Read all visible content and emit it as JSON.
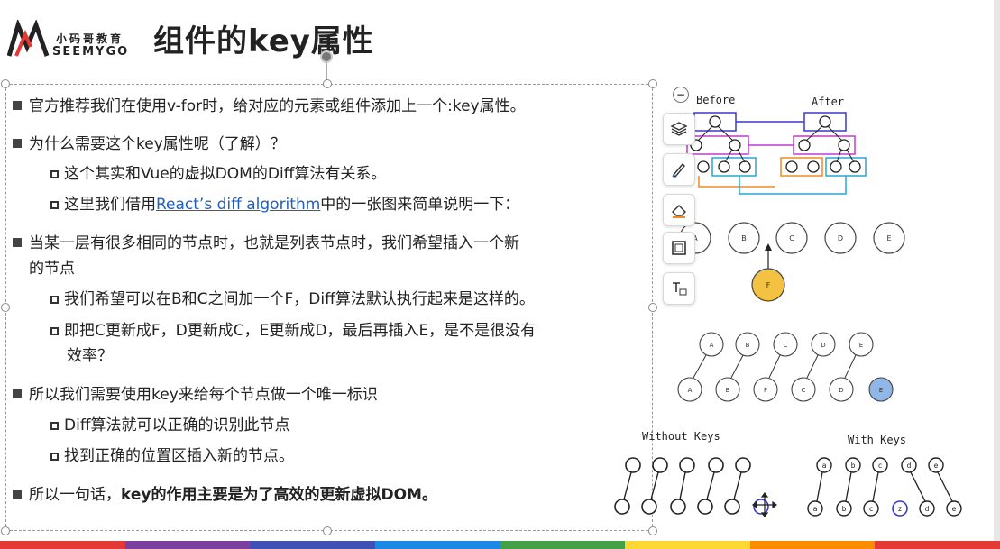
{
  "brand": {
    "name_cn": "小码哥教育",
    "name_en": "SEEMYGO",
    "accent": "#e53935"
  },
  "slide": {
    "title": "组件的key属性"
  },
  "content": {
    "l1": "官方推荐我们在使用v-for时，给对应的元素或组件添加上一个:key属性。",
    "l2": "为什么需要这个key属性呢（了解）？",
    "l3": "这个其实和Vue的虚拟DOM的Diff算法有关系。",
    "l4_pre": "这里我们借用",
    "l4_link": "React’s diff algorithm",
    "l4_post": "中的一张图来简单说明一下：",
    "l5a": "当某一层有很多相同的节点时，也就是列表节点时，我们希望插入一个新",
    "l5b": "的节点",
    "l6": "我们希望可以在B和C之间加一个F，Diff算法默认执行起来是这样的。",
    "l7a": "即把C更新成F，D更新成C，E更新成D，最后再插入E，是不是很没有",
    "l7b": "效率？",
    "l8": "所以我们需要使用key来给每个节点做一个唯一标识",
    "l9": "Diff算法就可以正确的识别此节点",
    "l10": "找到正确的位置区插入新的节点。",
    "l11_pre": "所以一句话，",
    "l11_bold": "key的作用主要是为了高效的更新虚拟DOM。"
  },
  "diagram": {
    "before_label": "Before",
    "after_label": "After",
    "nodes_row": [
      "A",
      "B",
      "C",
      "D",
      "E"
    ],
    "insert_node": "F",
    "mapping_top": [
      "A",
      "B",
      "C",
      "D",
      "E"
    ],
    "mapping_bottom": [
      "A",
      "B",
      "F",
      "C",
      "D",
      "E"
    ],
    "without_keys_label": "Without Keys",
    "with_keys_label": "With Keys",
    "keys_top": [
      "a",
      "b",
      "c",
      "d",
      "e"
    ],
    "keys_bottom": [
      "a",
      "b",
      "c",
      "z",
      "d",
      "e"
    ],
    "colors": {
      "insert_node": "#f4c242",
      "new_node": "#8fb8e8",
      "highlight_blue": "#3a3acc"
    }
  },
  "toolbar": {
    "collapse_icon": "−",
    "tools": [
      "layers-icon",
      "pen-icon",
      "eraser-icon",
      "frame-icon",
      "text-icon"
    ]
  },
  "rainbow": [
    "#e53935",
    "#7b3fa0",
    "#3f51b5",
    "#1e88e5",
    "#43a047",
    "#fdd835",
    "#fb8c00",
    "#e53935"
  ]
}
